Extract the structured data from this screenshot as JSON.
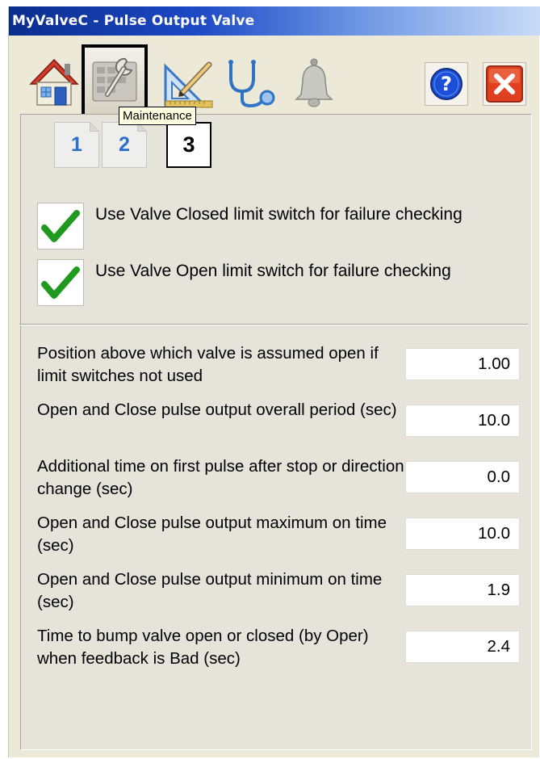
{
  "window": {
    "title": "MyValveC - Pulse Output Valve"
  },
  "toolbar": {
    "items": [
      {
        "name": "home",
        "icon": "home-icon"
      },
      {
        "name": "maintenance",
        "icon": "maintenance-icon",
        "selected": true
      },
      {
        "name": "engineering",
        "icon": "engineering-icon"
      },
      {
        "name": "diagnostics",
        "icon": "stethoscope-icon"
      },
      {
        "name": "alarms",
        "icon": "bell-icon"
      }
    ],
    "help_icon": "help-icon",
    "close_icon": "close-icon",
    "tooltip": "Maintenance"
  },
  "pages": {
    "tabs": [
      "1",
      "2",
      "3"
    ],
    "active": "3"
  },
  "checks": [
    {
      "checked": true,
      "label": "Use Valve Closed limit switch for failure checking"
    },
    {
      "checked": true,
      "label": "Use Valve Open limit switch for failure checking"
    }
  ],
  "params": [
    {
      "label": "Position above which valve is assumed open if limit switches not used",
      "value": "1.00"
    },
    {
      "label": "Open and Close pulse output overall period (sec)",
      "value": "10.0"
    },
    {
      "label": "Additional time on first pulse after stop or direction change (sec)",
      "value": "0.0"
    },
    {
      "label": "Open and Close pulse output maximum on time (sec)",
      "value": "10.0"
    },
    {
      "label": "Open and Close pulse output minimum on time (sec)",
      "value": "1.9"
    },
    {
      "label": "Time to bump valve open or closed (by Oper) when feedback is Bad (sec)",
      "value": "2.4"
    }
  ],
  "colors": {
    "titlebar_start": "#0a2d8c",
    "titlebar_end": "#c9dbf8",
    "page_tab_number": "#2a6fc8",
    "check_green": "#1f9a1f",
    "close_red": "#e0401f",
    "help_blue": "#1b4fd8"
  }
}
